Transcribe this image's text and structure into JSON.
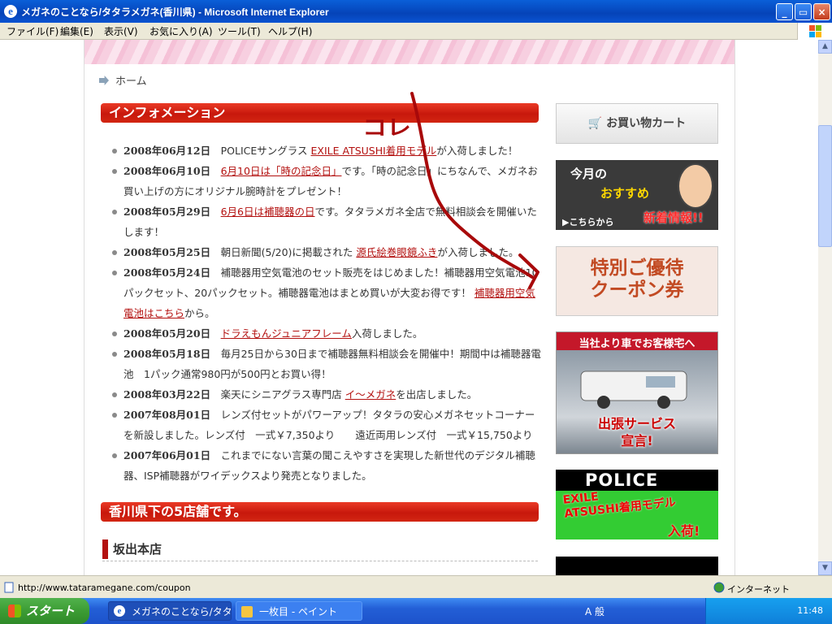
{
  "window": {
    "title": "メガネのことなら/タタラメガネ(香川県) - Microsoft Internet Explorer",
    "minimize_icon": "_",
    "maximize_icon": "▭",
    "close_icon": "×"
  },
  "menu": [
    "ファイル(F)",
    "編集(E)",
    "表示(V)",
    "お気に入り(A)",
    "ツール(T)",
    "ヘルプ(H)"
  ],
  "breadcrumb": {
    "label": "ホーム"
  },
  "info_heading": "インフォメーション",
  "annotation": "コレ",
  "news": [
    {
      "date": "2008年06月12日",
      "pre": "POLICEサングラス",
      "link": "EXILE ATSUSHI着用モデル",
      "post": "が入荷しました！"
    },
    {
      "date": "2008年06月10日",
      "pre": "",
      "link": "6月10日は「時の記念日」",
      "post": "です。「時の記念日」にちなんで、メガネお買い上げの方にオリジナル腕時計をプレゼント！"
    },
    {
      "date": "2008年05月29日",
      "pre": "",
      "link": "6月6日は補聴器の日",
      "post": "です。タタラメガネ全店で無料相談会を開催いたします！"
    },
    {
      "date": "2008年05月25日",
      "pre": "朝日新聞(5/20)に掲載された",
      "link": "源氏絵巻眼鏡ふき",
      "post": "が入荷しました。"
    },
    {
      "date": "2008年05月24日",
      "pre": "補聴器用空気電池のセット販売をはじめました！補聴器用空気電池10パックセット、20パックセット。補聴器電池はまとめ買いが大変お得です！",
      "link": "補聴器用空気電池はこちら",
      "post": "から。"
    },
    {
      "date": "2008年05月20日",
      "pre": "",
      "link": "ドラえもんジュニアフレーム",
      "post": "入荷しました。"
    },
    {
      "date": "2008年05月18日",
      "pre": "毎月25日から30日まで補聴器無料相談会を開催中！期間中は補聴器電池　1パック通常980円が500円とお買い得！",
      "link": "",
      "post": ""
    },
    {
      "date": "2008年03月22日",
      "pre": "楽天にシニアグラス専門店",
      "link": "イ～メガネ",
      "post": "を出店しました。"
    },
    {
      "date": "2007年08月01日",
      "pre": "レンズ付セットがパワーアップ！タタラの安心メガネセットコーナーを新設しました。レンズ付　一式￥7,350より　　遠近両用レンズ付　一式￥15,750より",
      "link": "",
      "post": ""
    },
    {
      "date": "2007年06月01日",
      "pre": "これまでにない言葉の聞こえやすさを実現した新世代のデジタル補聴器、ISP補聴器がワイデックスより発売となりました。",
      "link": "",
      "post": ""
    }
  ],
  "stores_heading": "香川県下の5店舗です。",
  "store_name": "坂出本店",
  "sidebar": {
    "cart_icon": "🛒",
    "cart_label": "お買い物カート",
    "banner2": {
      "line1": "今月の",
      "line2": "おすすめ",
      "line3": "新着情報!!",
      "line4": "▶こちらから"
    },
    "banner3": {
      "line1": "特別ご優待",
      "line2": "クーポン券"
    },
    "banner4": {
      "line1": "当社より車でお客様宅へ",
      "line2": "出張サービス",
      "line3": "宣言!"
    },
    "banner5": {
      "line1": "POLICE",
      "line2": "EXILE",
      "line3": "ATSUSHI着用モデル",
      "line4": "入荷!"
    }
  },
  "status": {
    "url": "http://www.tataramegane.com/coupon",
    "zone": "インターネット"
  },
  "taskbar": {
    "start": "スタート",
    "tasks": [
      "メガネのことなら/タタラメ...",
      "一枚目 - ペイント"
    ],
    "ime": "A 般",
    "clock": "11:48"
  },
  "colors": {
    "accent_red": "#c8180c",
    "link_red": "#b3100f",
    "xp_blue": "#0a54d2"
  }
}
